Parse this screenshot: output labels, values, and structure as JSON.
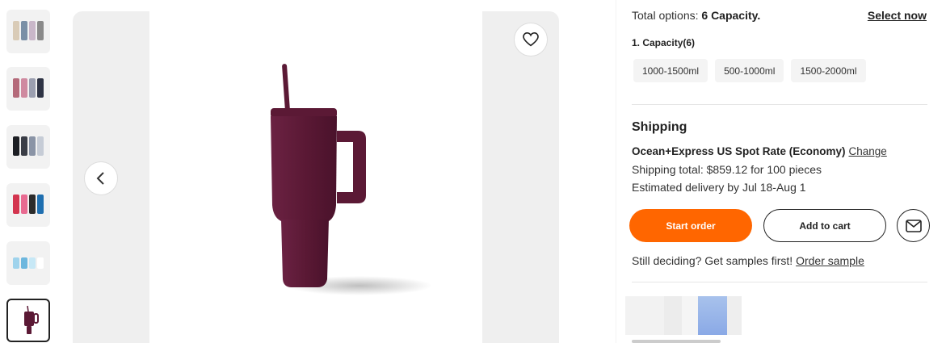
{
  "thumbnails": [
    {
      "name": "thumbnail-1",
      "colors": [
        "#d9cbb7",
        "#7a8fa6",
        "#c9b7c9",
        "#8a8a8a"
      ]
    },
    {
      "name": "thumbnail-2",
      "colors": [
        "#b46a7a",
        "#cf8aa0",
        "#9b9fb0",
        "#2e3344"
      ]
    },
    {
      "name": "thumbnail-3",
      "colors": [
        "#1d1f24",
        "#3a3d46",
        "#8a94a6",
        "#c6ccd6"
      ]
    },
    {
      "name": "thumbnail-4",
      "colors": [
        "#d3354f",
        "#e86a91",
        "#2b2b2b",
        "#1f6fb0"
      ]
    },
    {
      "name": "thumbnail-5",
      "colors": [
        "#9fd3ec",
        "#6db7de",
        "#c7e8f6",
        "#ffffff"
      ]
    },
    {
      "name": "thumbnail-6",
      "colors": [
        "#5b1935"
      ]
    }
  ],
  "gallery": {
    "product_color": "#5b1935",
    "favorite_icon": "heart-icon",
    "prev_icon": "chevron-left-icon"
  },
  "options": {
    "total_prefix": "Total options:",
    "total_value": "6 Capacity.",
    "select_now": "Select now",
    "capacity_label": "1. Capacity(6)",
    "capacities": [
      "1000-1500ml",
      "500-1000ml",
      "1500-2000ml"
    ]
  },
  "shipping": {
    "title": "Shipping",
    "method": "Ocean+Express US Spot Rate (Economy)",
    "change": "Change",
    "total": "Shipping total: $859.12 for 100 pieces",
    "estimate": "Estimated delivery by Jul 18-Aug 1"
  },
  "actions": {
    "start_order": "Start order",
    "add_to_cart": "Add to cart",
    "message_icon": "mail-icon"
  },
  "samples": {
    "prefix": "Still deciding? Get samples first!",
    "link": "Order sample"
  },
  "colors": {
    "accent": "#ff6600",
    "gallery_bg": "#efefef",
    "chip_bg": "#f4f4f4"
  }
}
